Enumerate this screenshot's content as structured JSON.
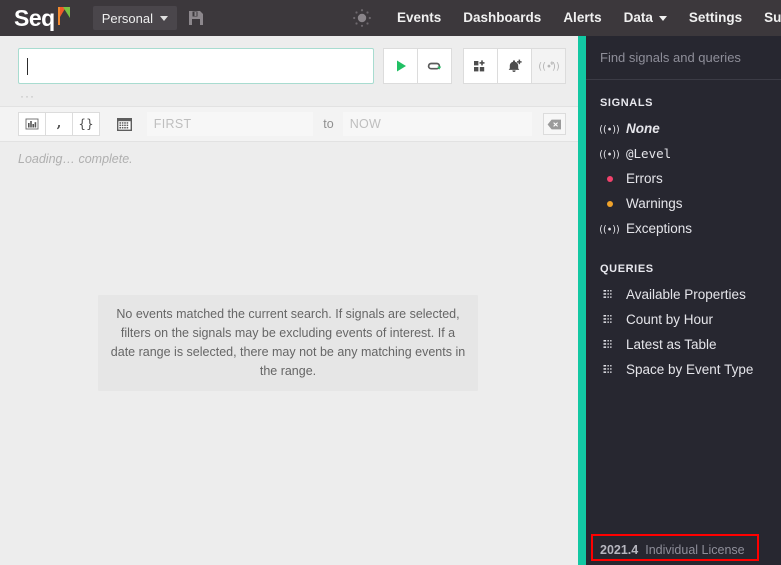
{
  "topbar": {
    "logo_text": "Seq",
    "logo_icon": "flag-icon",
    "scope_label": "Personal",
    "scope_chevron_icon": "chevron-down-icon",
    "save_icon": "floppy-save-icon",
    "spinner_icon": "spinner-icon",
    "nav": [
      {
        "label": "Events",
        "has_chevron": false
      },
      {
        "label": "Dashboards",
        "has_chevron": false
      },
      {
        "label": "Alerts",
        "has_chevron": false
      },
      {
        "label": "Data",
        "has_chevron": true
      },
      {
        "label": "Settings",
        "has_chevron": false
      },
      {
        "label": "Supp",
        "has_chevron": false
      }
    ]
  },
  "search": {
    "value": "",
    "placeholder": "",
    "buttons": [
      {
        "name": "run-query-button",
        "icon": "play-icon",
        "disabled": false
      },
      {
        "name": "refresh-loop-button",
        "icon": "loop-refresh-icon",
        "disabled": false
      },
      {
        "name": "add-to-dashboard-button",
        "icon": "grid-plus-icon",
        "disabled": false
      },
      {
        "name": "create-alert-button",
        "icon": "bell-plus-icon",
        "disabled": false
      },
      {
        "name": "create-signal-button",
        "icon": "signal-plus-icon",
        "disabled": true
      }
    ],
    "ellipsis": "···"
  },
  "daterow": {
    "view_buttons": [
      {
        "name": "chart-view-button",
        "icon": "bar-chart-icon"
      },
      {
        "name": "raw-view-button",
        "icon": "comma-quote-icon"
      },
      {
        "name": "json-view-button",
        "icon": "braces-icon"
      }
    ],
    "calendar_icon": "calendar-icon",
    "from_placeholder": "FIRST",
    "from_value": "",
    "to_label": "to",
    "to_placeholder": "NOW",
    "to_value": "",
    "clear_icon": "backspace-clear-icon"
  },
  "status": {
    "loading_text": "Loading… complete."
  },
  "empty_state": {
    "message": "No events matched the current search. If signals are selected, filters on the signals may be excluding events of interest. If a date range is selected, there may not be any matching events in the range."
  },
  "sidebar": {
    "search_placeholder": "Find signals and queries",
    "signals_title": "SIGNALS",
    "signals": [
      {
        "label": "None",
        "icon": "signal-icon",
        "style": "italic",
        "color": ""
      },
      {
        "label": "@Level",
        "icon": "signal-icon",
        "style": "mono",
        "color": ""
      },
      {
        "label": "Errors",
        "icon": "dot-icon",
        "style": "",
        "color": "#F2426C"
      },
      {
        "label": "Warnings",
        "icon": "dot-icon",
        "style": "",
        "color": "#F0A32B"
      },
      {
        "label": "Exceptions",
        "icon": "signal-icon",
        "style": "",
        "color": ""
      }
    ],
    "queries_title": "QUERIES",
    "queries": [
      {
        "label": "Available Properties",
        "icon": "table-dots-icon"
      },
      {
        "label": "Count by Hour",
        "icon": "table-dots-icon"
      },
      {
        "label": "Latest as Table",
        "icon": "table-dots-icon"
      },
      {
        "label": "Space by Event Type",
        "icon": "table-dots-icon"
      }
    ],
    "footer": {
      "version": "2021.4",
      "license": "Individual License"
    }
  },
  "colors": {
    "accent_teal": "#12C8A3",
    "topbar": "#3C383C",
    "sidebar": "#272730",
    "error": "#F2426C",
    "warning": "#F0A32B",
    "play_green": "#21C064",
    "highlight": "#FF0000"
  }
}
